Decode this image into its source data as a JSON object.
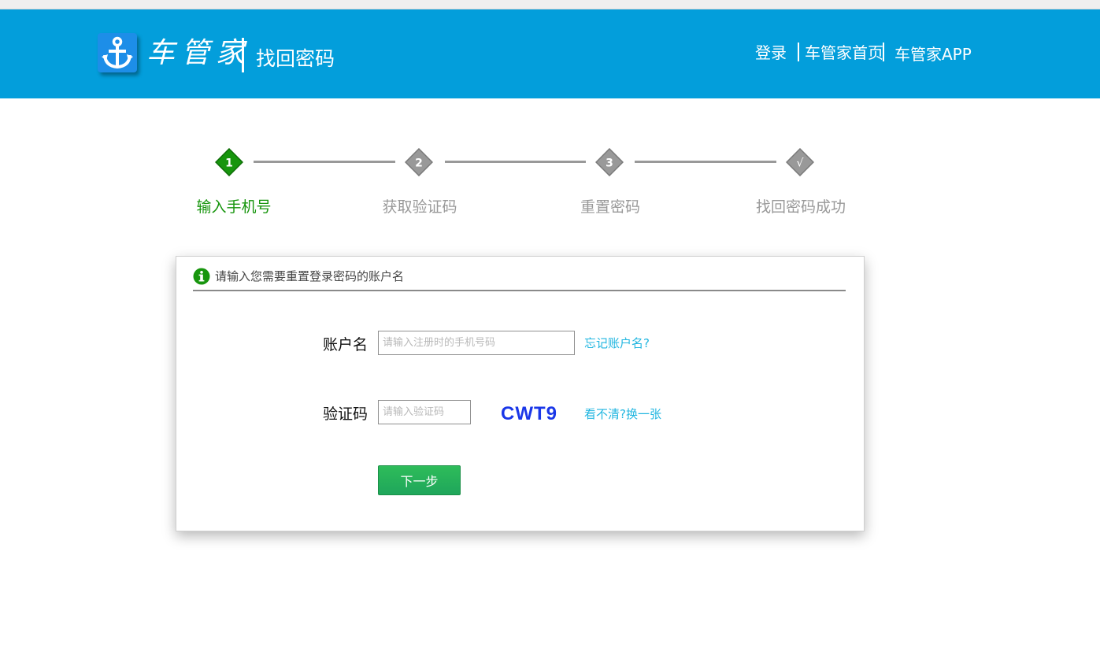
{
  "header": {
    "brand_name": "车管家",
    "page_title": "找回密码",
    "nav": {
      "login": "登录",
      "home": "车管家首页",
      "app": "车管家APP"
    }
  },
  "steps": [
    {
      "badge": "1",
      "label": "输入手机号",
      "active": true
    },
    {
      "badge": "2",
      "label": "获取验证码",
      "active": false
    },
    {
      "badge": "3",
      "label": "重置密码",
      "active": false
    },
    {
      "badge": "√",
      "label": "找回密码成功",
      "active": false
    }
  ],
  "form": {
    "instruction": "请输入您需要重置登录密码的账户名",
    "account": {
      "label": "账户名",
      "placeholder": "请输入注册时的手机号码",
      "forgot_link": "忘记账户名?"
    },
    "captcha": {
      "label": "验证码",
      "placeholder": "请输入验证码",
      "code": "CWT9",
      "refresh_link": "看不清?换一张"
    },
    "next_button": "下一步"
  },
  "colors": {
    "header_bg": "#039edb",
    "active_step": "#17950d",
    "inactive_step": "#999999",
    "link": "#21b6e0",
    "captcha": "#1a37e8",
    "button": "#22ad5a"
  }
}
